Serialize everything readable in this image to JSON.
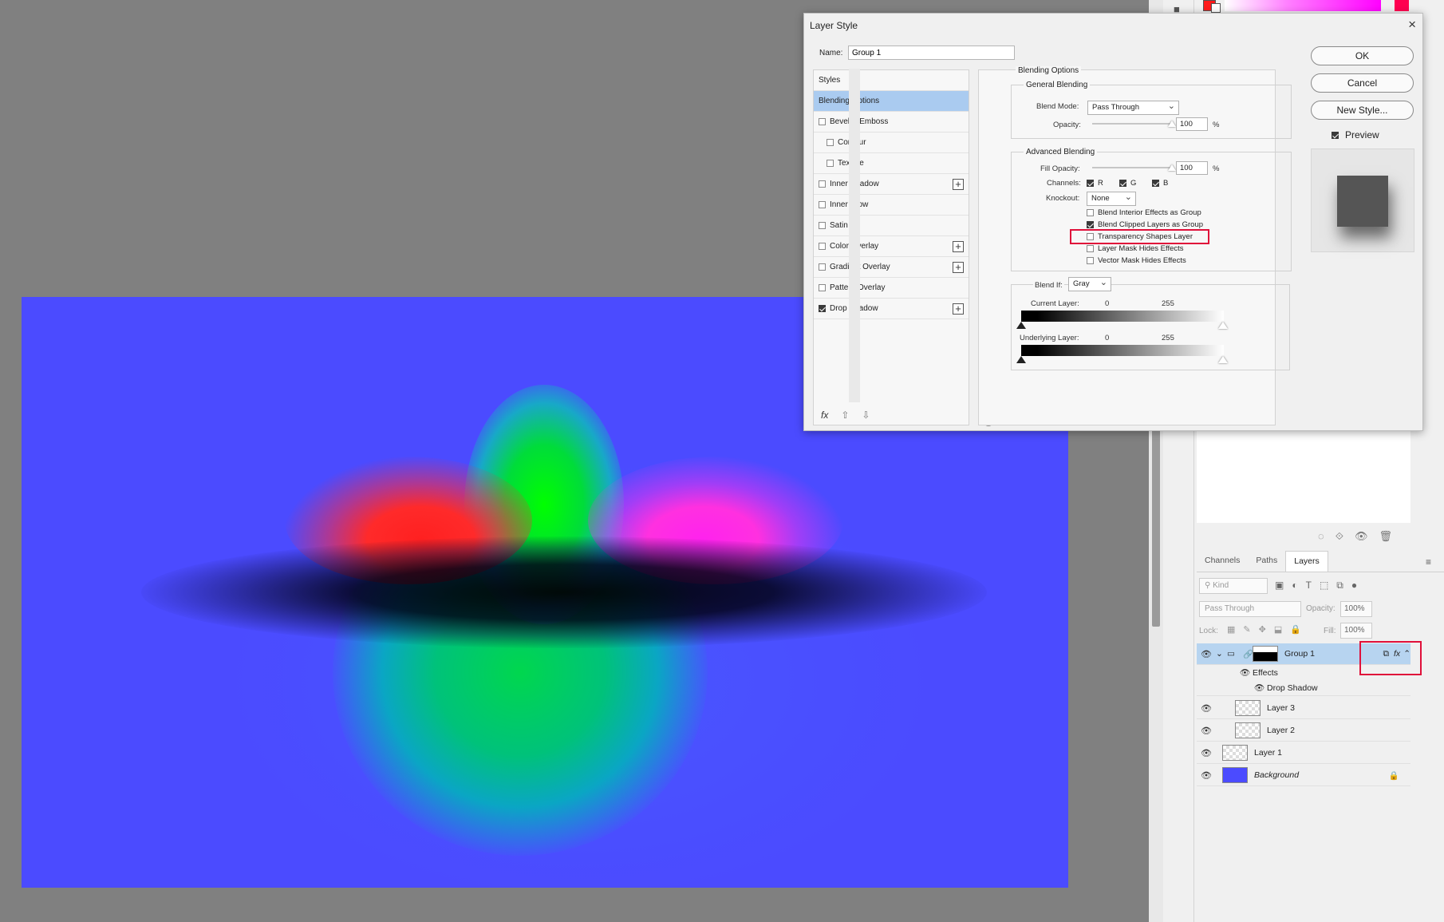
{
  "dialog": {
    "title": "Layer Style",
    "close_icon": "×",
    "name_label": "Name:",
    "name_value": "Group 1",
    "buttons": {
      "ok": "OK",
      "cancel": "Cancel",
      "new_style": "New Style..."
    },
    "preview_label": "Preview",
    "preview_checked": true
  },
  "styles": {
    "header": "Styles",
    "items": [
      {
        "label": "Blending Options",
        "checkbox": false,
        "selected": true
      },
      {
        "label": "Bevel & Emboss",
        "checkbox": true,
        "checked": false
      },
      {
        "label": "Contour",
        "checkbox": true,
        "checked": false,
        "indent": true
      },
      {
        "label": "Texture",
        "checkbox": true,
        "checked": false,
        "indent": true
      },
      {
        "label": "Inner Shadow",
        "checkbox": true,
        "checked": false,
        "plus": true
      },
      {
        "label": "Inner Glow",
        "checkbox": true,
        "checked": false
      },
      {
        "label": "Satin",
        "checkbox": true,
        "checked": false
      },
      {
        "label": "Color Overlay",
        "checkbox": true,
        "checked": false,
        "plus": true
      },
      {
        "label": "Gradient Overlay",
        "checkbox": true,
        "checked": false,
        "plus": true
      },
      {
        "label": "Pattern Overlay",
        "checkbox": true,
        "checked": false
      },
      {
        "label": "Drop Shadow",
        "checkbox": true,
        "checked": true,
        "plus": true
      }
    ],
    "footer": {
      "fx": "fx",
      "up_icon": "⇧",
      "down_icon": "⇩",
      "trash_icon": "🗑"
    }
  },
  "blending": {
    "section": "Blending Options",
    "general": {
      "title": "General Blending",
      "blend_mode_label": "Blend Mode:",
      "blend_mode": "Pass Through",
      "opacity_label": "Opacity:",
      "opacity": "100",
      "opacity_unit": "%",
      "opacity_level": 1.0
    },
    "advanced": {
      "title": "Advanced Blending",
      "fill_opacity_label": "Fill Opacity:",
      "fill_opacity": "100",
      "fill_unit": "%",
      "fill_level": 1.0,
      "channels_label": "Channels:",
      "channels": [
        {
          "label": "R",
          "checked": true
        },
        {
          "label": "G",
          "checked": true
        },
        {
          "label": "B",
          "checked": true
        }
      ],
      "knockout_label": "Knockout:",
      "knockout": "None",
      "options": [
        {
          "label": "Blend Interior Effects as Group",
          "checked": false
        },
        {
          "label": "Blend Clipped Layers as Group",
          "checked": true
        },
        {
          "label": "Transparency Shapes Layer",
          "checked": false,
          "highlighted": true
        },
        {
          "label": "Layer Mask Hides Effects",
          "checked": false
        },
        {
          "label": "Vector Mask Hides Effects",
          "checked": false
        }
      ]
    },
    "blend_if": {
      "label": "Blend If:",
      "channel": "Gray",
      "current_label": "Current Layer:",
      "current_min": "0",
      "current_max": "255",
      "underlying_label": "Underlying Layer:",
      "underlying_min": "0",
      "underlying_max": "255"
    }
  },
  "layers_panel": {
    "tabs": [
      "Channels",
      "Paths",
      "Layers"
    ],
    "active_tab": "Layers",
    "menu_icon": "≡",
    "kind_placeholder": "Kind",
    "blend": "Pass Through",
    "opacity_label": "Opacity:",
    "opacity": "100%",
    "lock_label": "Lock:",
    "fill_label": "Fill:",
    "fill": "100%",
    "layers": [
      {
        "name": "Group 1",
        "type": "group",
        "visible": true,
        "selected": true,
        "fx": "fx"
      },
      {
        "name": "Effects",
        "type": "effects"
      },
      {
        "name": "Drop Shadow",
        "type": "effect"
      },
      {
        "name": "Layer 3",
        "type": "pixel",
        "visible": true
      },
      {
        "name": "Layer 2",
        "type": "pixel",
        "visible": true
      },
      {
        "name": "Layer 1",
        "type": "pixel",
        "visible": true
      },
      {
        "name": "Background",
        "type": "background",
        "visible": true,
        "locked": true
      }
    ]
  },
  "colors": {
    "canvas_bg": "#4b4bff",
    "highlight": "#e0103a",
    "selected_row": "#aacbf0",
    "foreground_swatch": "#ff1a1a"
  },
  "icons": {
    "eye": "eye-icon",
    "lock": "lock-icon",
    "folder": "folder-icon",
    "link": "link-icon",
    "close": "close-icon"
  }
}
